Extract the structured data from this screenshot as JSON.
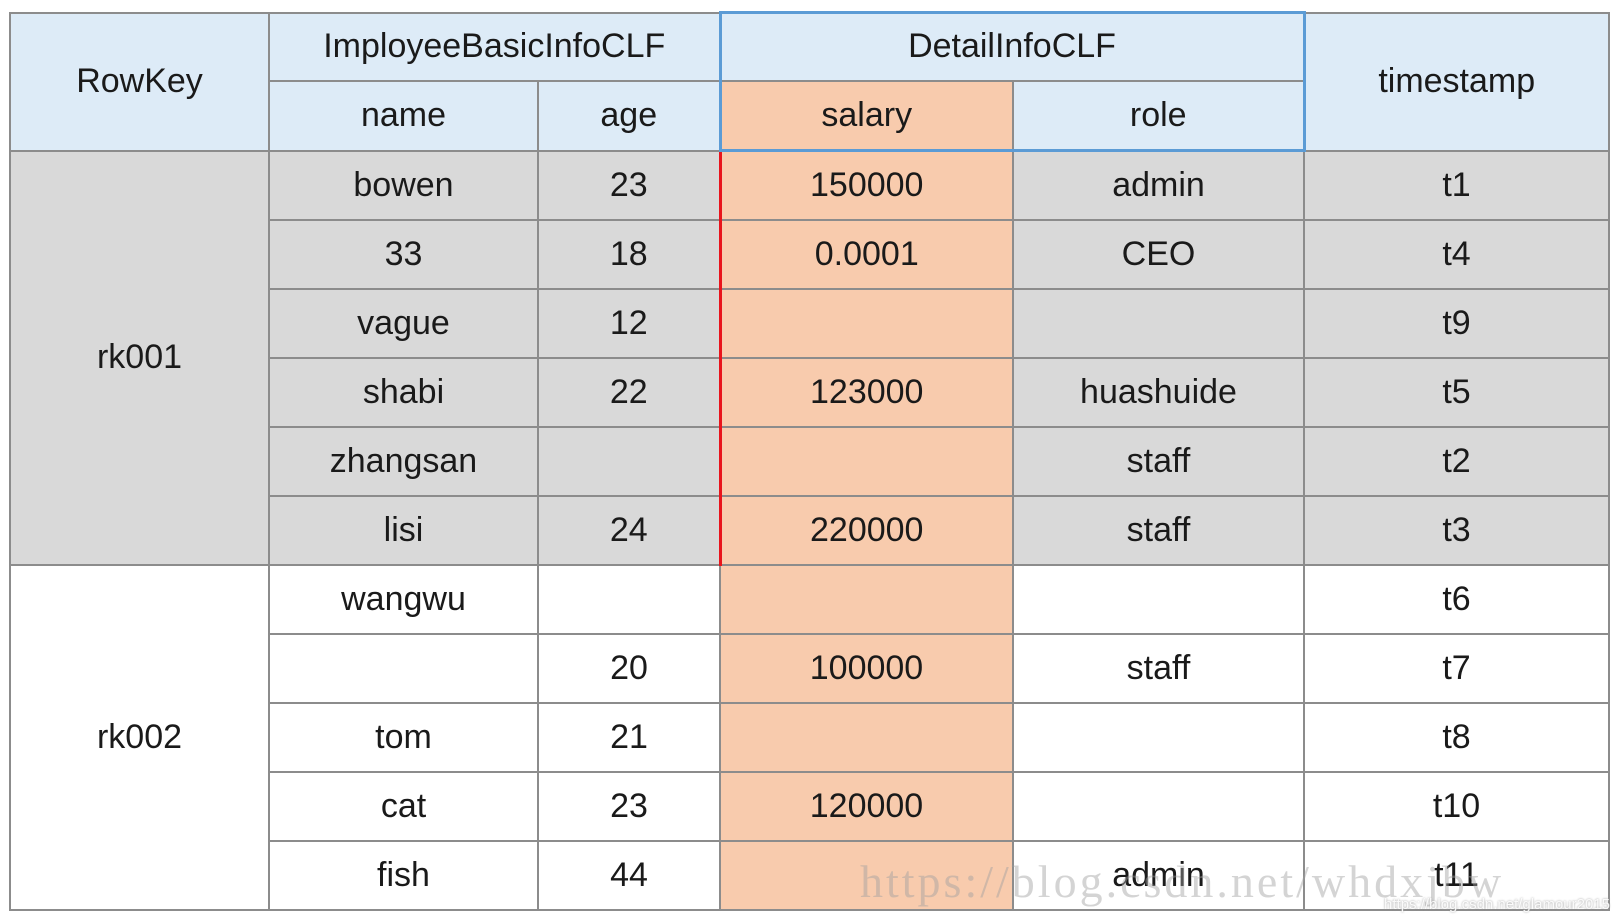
{
  "header": {
    "rowkey": "RowKey",
    "family1": "ImployeeBasicInfoCLF",
    "family2": "DetailInfoCLF",
    "timestamp": "timestamp",
    "columns": [
      "name",
      "age",
      "salary",
      "role"
    ]
  },
  "groups": [
    {
      "rowkey": "rk001",
      "rows": [
        {
          "name": "bowen",
          "age": "23",
          "salary": "150000",
          "role": "admin",
          "ts": "t1"
        },
        {
          "name": "33",
          "age": "18",
          "salary": "0.0001",
          "role": "CEO",
          "ts": "t4"
        },
        {
          "name": "vague",
          "age": "12",
          "salary": "",
          "role": "",
          "ts": "t9"
        },
        {
          "name": "shabi",
          "age": "22",
          "salary": "123000",
          "role": "huashuide",
          "ts": "t5"
        },
        {
          "name": "zhangsan",
          "age": "",
          "salary": "",
          "role": "staff",
          "ts": "t2"
        },
        {
          "name": "lisi",
          "age": "24",
          "salary": "220000",
          "role": "staff",
          "ts": "t3"
        }
      ]
    },
    {
      "rowkey": "rk002",
      "rows": [
        {
          "name": "wangwu",
          "age": "",
          "salary": "",
          "role": "",
          "ts": "t6"
        },
        {
          "name": "",
          "age": "20",
          "salary": "100000",
          "role": "staff",
          "ts": "t7"
        },
        {
          "name": "tom",
          "age": "21",
          "salary": "",
          "role": "",
          "ts": "t8"
        },
        {
          "name": "cat",
          "age": "23",
          "salary": "120000",
          "role": "",
          "ts": "t10"
        },
        {
          "name": "fish",
          "age": "44",
          "salary": "",
          "role": "admin",
          "ts": "t11"
        }
      ]
    }
  ],
  "colors": {
    "header": "#ddebf7",
    "highlight_column": "#f8cbad",
    "group1": "#d9d9d9",
    "family_border": "#5b9bd5",
    "marker_line": "#e8141c"
  },
  "watermark": "https://blog.csdn.net/whdxjbw",
  "watermark_small": "https://blog.csdn.net/glamour2015"
}
